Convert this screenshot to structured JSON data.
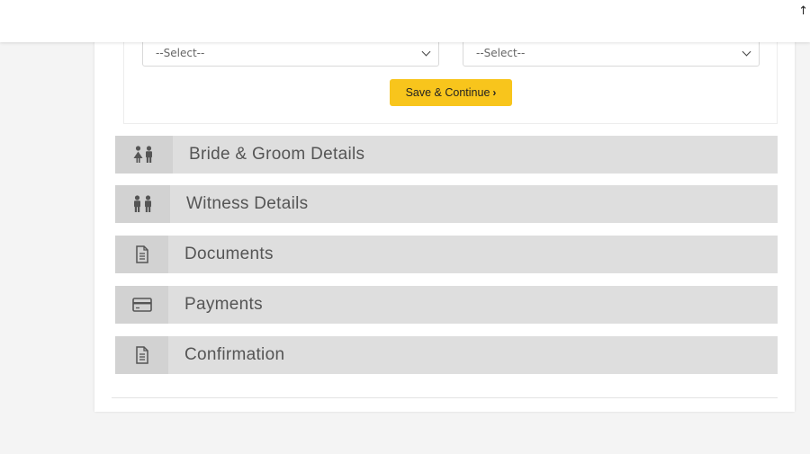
{
  "topbar": {
    "corner_glyph": "↑"
  },
  "form": {
    "select_left": {
      "value": "--Select--"
    },
    "select_right": {
      "value": "--Select--"
    },
    "save_button": {
      "label": "Save & Continue",
      "arrow": "›",
      "color": "#f8c51c"
    }
  },
  "steps": [
    {
      "label": "Bride & Groom Details",
      "icon": "couple-icon"
    },
    {
      "label": "Witness Details",
      "icon": "people-icon"
    },
    {
      "label": "Documents",
      "icon": "document-icon"
    },
    {
      "label": "Payments",
      "icon": "credit-card-icon"
    },
    {
      "label": "Confirmation",
      "icon": "document-icon"
    }
  ]
}
